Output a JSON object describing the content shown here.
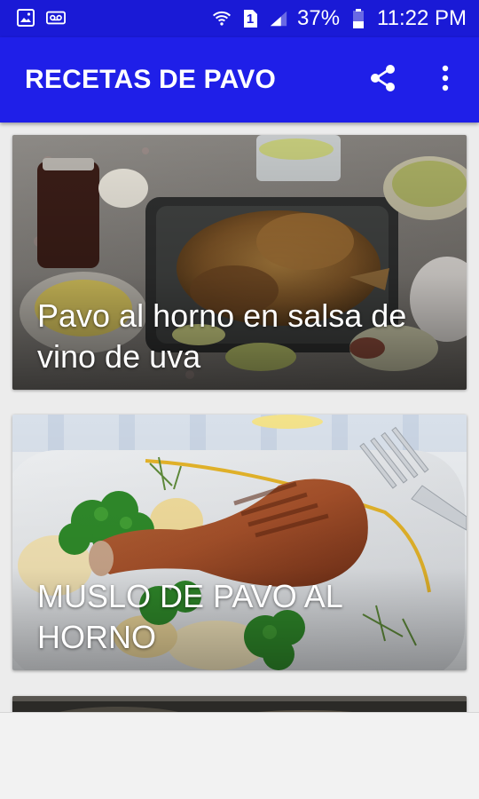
{
  "status_bar": {
    "battery": "37%",
    "time": "11:22 PM",
    "sim_slot": "1",
    "icons": [
      "image-icon",
      "voicemail-icon",
      "wifi-icon",
      "sim-icon",
      "signal-icon",
      "battery-icon"
    ]
  },
  "app_bar": {
    "title": "RECETAS DE PAVO",
    "actions": [
      "share-icon",
      "more-vert-icon"
    ]
  },
  "recipes": [
    {
      "title": "Pavo al horno en salsa de vino de uva"
    },
    {
      "title": "MUSLO DE PAVO AL HORNO"
    },
    {
      "title": ""
    }
  ],
  "colors": {
    "status_bar": "#1a1ad6",
    "app_bar": "#1f1fe8",
    "background": "#ececec"
  }
}
